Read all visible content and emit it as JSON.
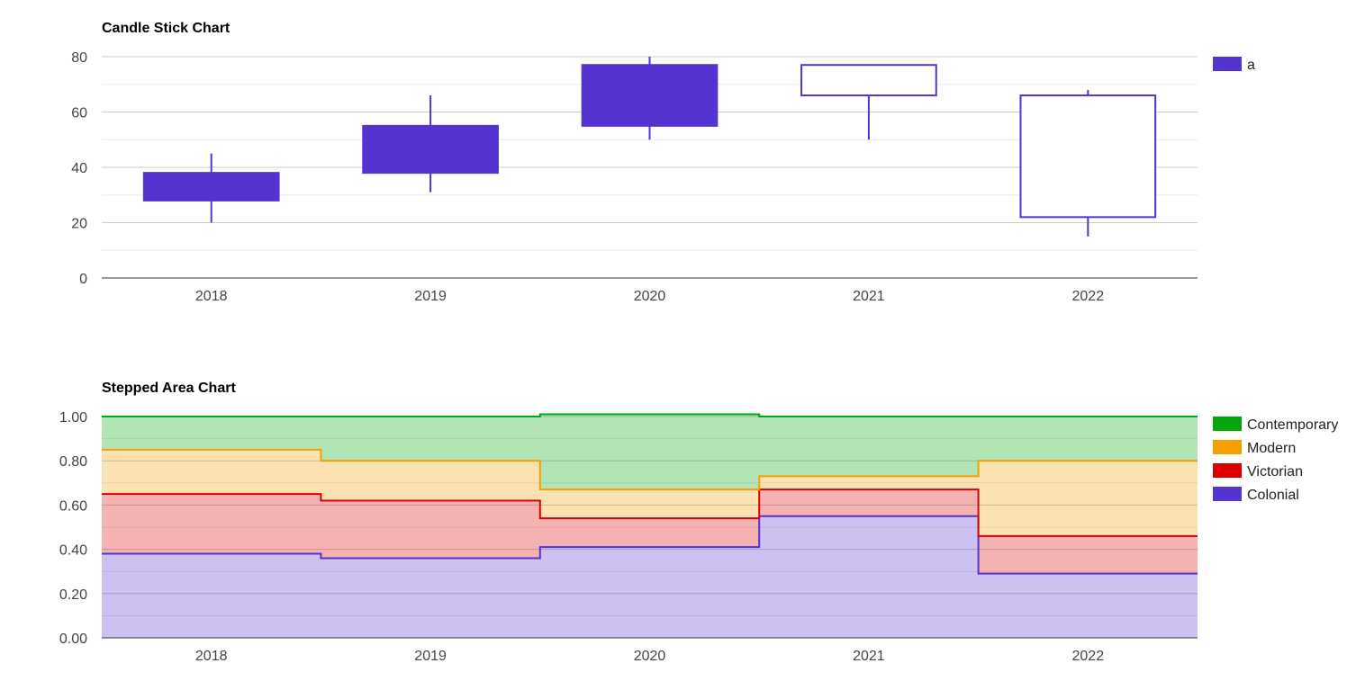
{
  "chart_data": [
    {
      "type": "candlestick",
      "title": "Candle Stick Chart",
      "categories": [
        "2018",
        "2019",
        "2020",
        "2021",
        "2022"
      ],
      "series": [
        {
          "name": "a",
          "color": "#5533d0",
          "candles": [
            {
              "low": 20,
              "open": 28,
              "close": 38,
              "high": 45
            },
            {
              "low": 31,
              "open": 38,
              "close": 55,
              "high": 66
            },
            {
              "low": 50,
              "open": 55,
              "close": 77,
              "high": 80
            },
            {
              "low": 50,
              "open": 77,
              "close": 66,
              "high": 77
            },
            {
              "low": 15,
              "open": 66,
              "close": 22,
              "high": 68
            }
          ]
        }
      ],
      "yticks": [
        "0",
        "20",
        "40",
        "60",
        "80"
      ],
      "ylim": [
        0,
        80
      ],
      "legend_position": "right",
      "grid": true
    },
    {
      "type": "area",
      "stepped": true,
      "stacked": "percent",
      "title": "Stepped Area Chart",
      "categories": [
        "2018",
        "2019",
        "2020",
        "2021",
        "2022"
      ],
      "series": [
        {
          "name": "Colonial",
          "color": "#5533d0",
          "values": [
            0.38,
            0.36,
            0.41,
            0.55,
            0.29
          ]
        },
        {
          "name": "Victorian",
          "color": "#dd0000",
          "values": [
            0.27,
            0.26,
            0.13,
            0.12,
            0.17
          ]
        },
        {
          "name": "Modern",
          "color": "#f5a000",
          "values": [
            0.2,
            0.18,
            0.13,
            0.06,
            0.34
          ]
        },
        {
          "name": "Contemporary",
          "color": "#00a80e",
          "values": [
            0.15,
            0.2,
            0.34,
            0.27,
            0.2
          ]
        }
      ],
      "legend_order": [
        "Contemporary",
        "Modern",
        "Victorian",
        "Colonial"
      ],
      "yticks": [
        "0.00",
        "0.20",
        "0.40",
        "0.60",
        "0.80",
        "1.00"
      ],
      "ylim": [
        0,
        1
      ],
      "legend_position": "right",
      "grid": true
    }
  ]
}
